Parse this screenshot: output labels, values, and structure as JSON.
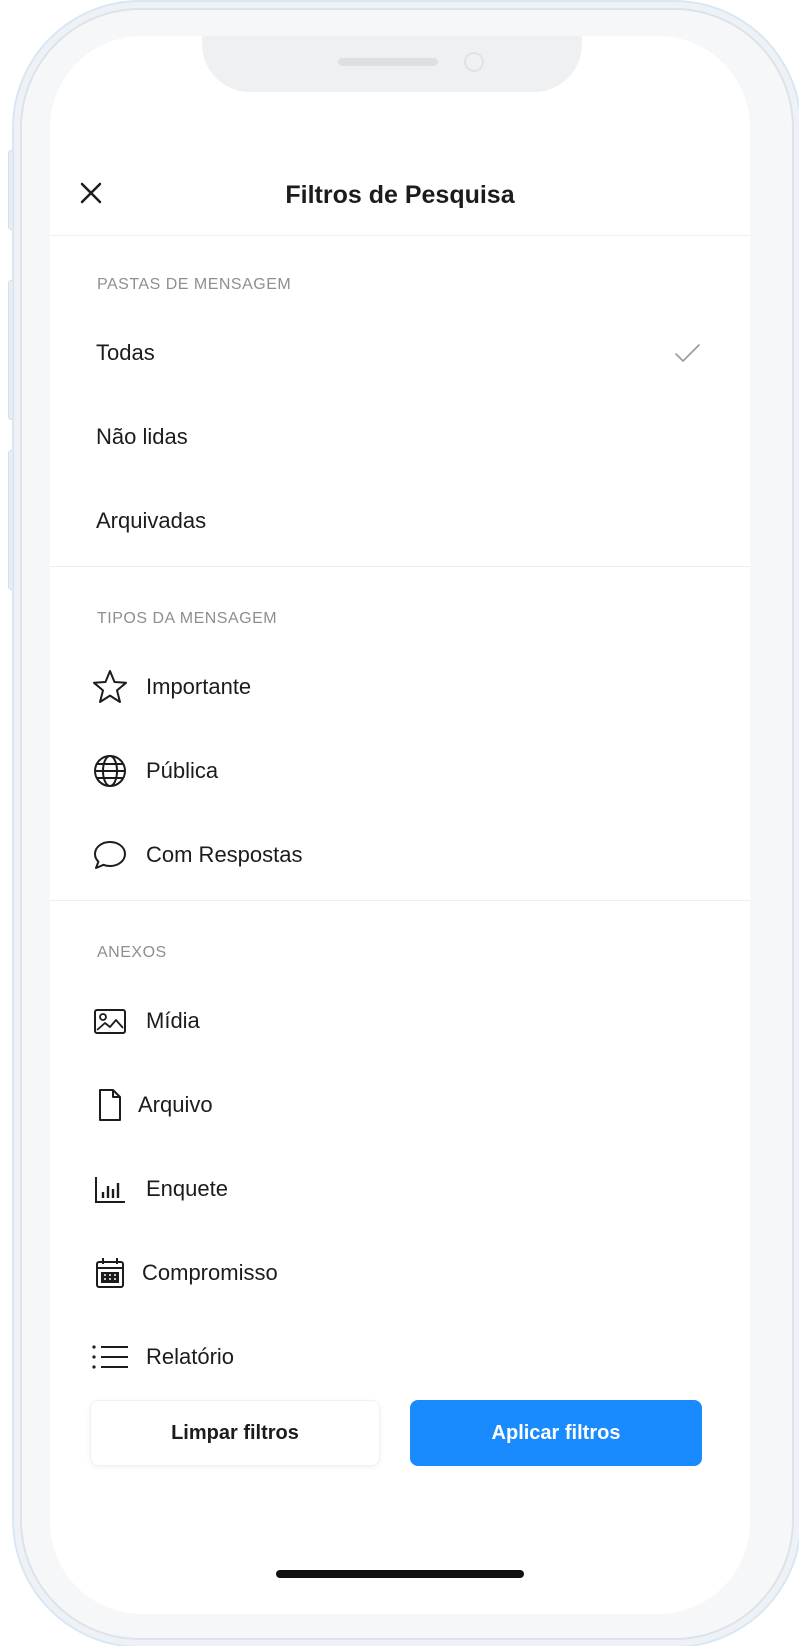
{
  "header": {
    "title": "Filtros de Pesquisa"
  },
  "folders": {
    "section_label": "PASTAS DE MENSAGEM",
    "items": [
      {
        "label": "Todas",
        "selected": true
      },
      {
        "label": "Não lidas",
        "selected": false
      },
      {
        "label": "Arquivadas",
        "selected": false
      }
    ]
  },
  "types": {
    "section_label": "TIPOS DA MENSAGEM",
    "items": [
      {
        "label": "Importante",
        "icon": "star-icon"
      },
      {
        "label": "Pública",
        "icon": "globe-icon"
      },
      {
        "label": "Com Respostas",
        "icon": "speech-bubble-icon"
      }
    ]
  },
  "attachments": {
    "section_label": "ANEXOS",
    "items": [
      {
        "label": "Mídia",
        "icon": "image-icon"
      },
      {
        "label": "Arquivo",
        "icon": "file-icon"
      },
      {
        "label": "Enquete",
        "icon": "bar-chart-icon"
      },
      {
        "label": "Compromisso",
        "icon": "calendar-icon"
      },
      {
        "label": "Relatório",
        "icon": "list-icon"
      }
    ]
  },
  "footer": {
    "clear_label": "Limpar filtros",
    "apply_label": "Aplicar filtros"
  },
  "colors": {
    "accent": "#1a8bff",
    "muted_label": "#8e8e93",
    "text": "#1c1c1e"
  }
}
